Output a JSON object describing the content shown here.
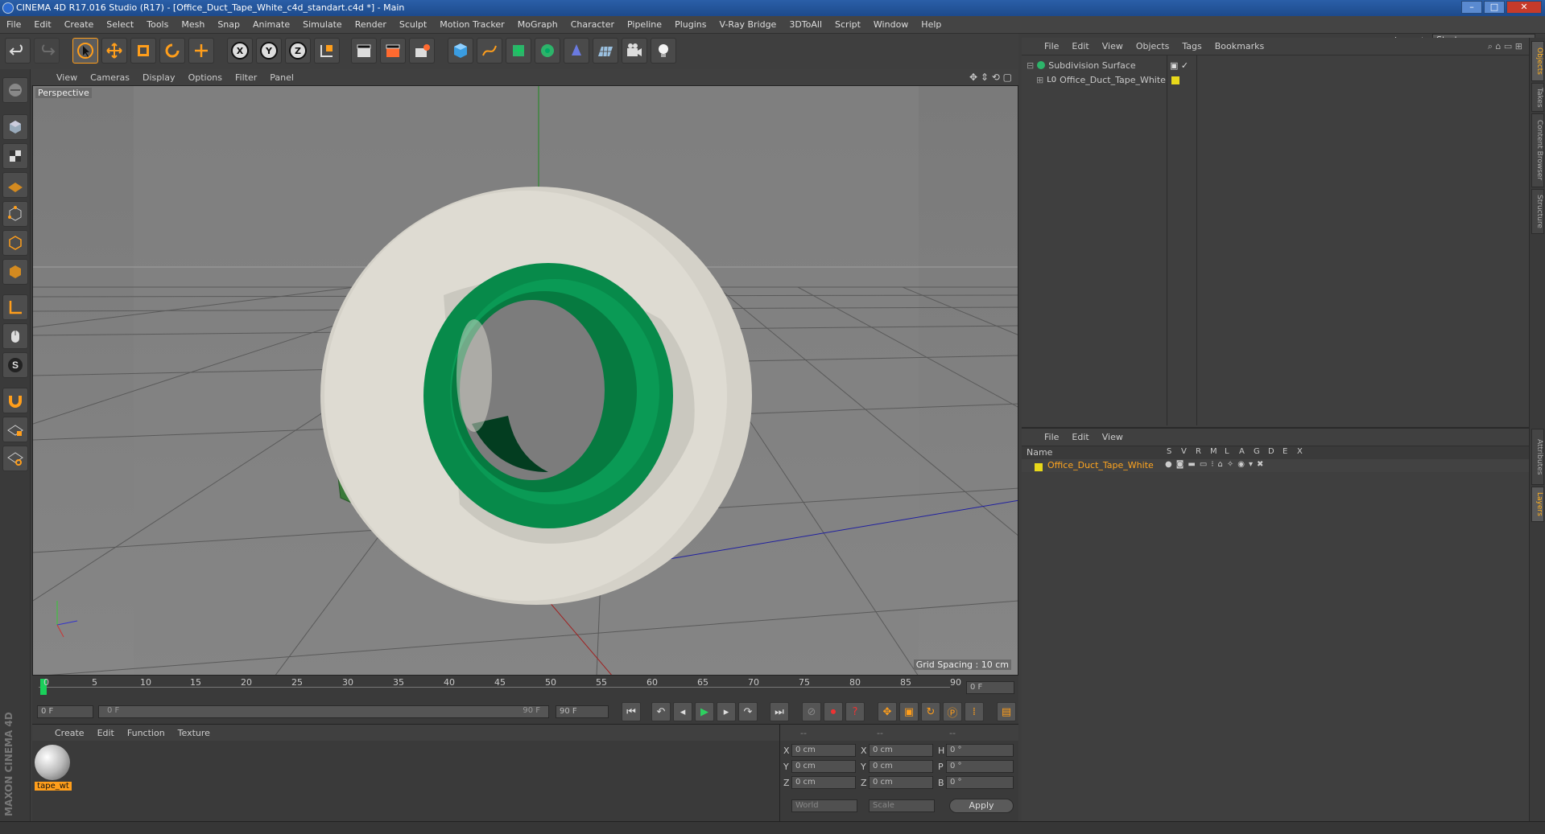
{
  "window": {
    "title": "CINEMA 4D R17.016 Studio (R17) - [Office_Duct_Tape_White_c4d_standart.c4d *] - Main",
    "min": "–",
    "max": "□",
    "close": "✕"
  },
  "menu": [
    "File",
    "Edit",
    "Create",
    "Select",
    "Tools",
    "Mesh",
    "Snap",
    "Animate",
    "Simulate",
    "Render",
    "Sculpt",
    "Motion Tracker",
    "MoGraph",
    "Character",
    "Pipeline",
    "Plugins",
    "V-Ray Bridge",
    "3DToAll",
    "Script",
    "Window",
    "Help"
  ],
  "layout": {
    "label": "Layout:",
    "value": "Startup"
  },
  "toolbar": {
    "x_label": "X",
    "y_label": "Y",
    "z_label": "Z"
  },
  "viewport": {
    "menu": [
      "View",
      "Cameras",
      "Display",
      "Options",
      "Filter",
      "Panel"
    ],
    "label": "Perspective",
    "grid_spacing": "Grid Spacing : 10 cm"
  },
  "timeline": {
    "ticks": [
      "0",
      "5",
      "10",
      "15",
      "20",
      "25",
      "30",
      "35",
      "40",
      "45",
      "50",
      "55",
      "60",
      "65",
      "70",
      "75",
      "80",
      "85",
      "90"
    ],
    "frame_field": "0 F"
  },
  "transport": {
    "start": "0 F",
    "range_start": "0 F",
    "range_end": "90 F",
    "end": "90 F"
  },
  "materials": {
    "menu": [
      "Create",
      "Edit",
      "Function",
      "Texture"
    ],
    "items": [
      {
        "name": "tape_wt"
      }
    ]
  },
  "coords": {
    "headers": [
      "--",
      "--",
      "--"
    ],
    "rows": [
      {
        "a": "X",
        "av": "0 cm",
        "b": "X",
        "bv": "0 cm",
        "c": "H",
        "cv": "0 °"
      },
      {
        "a": "Y",
        "av": "0 cm",
        "b": "Y",
        "bv": "0 cm",
        "c": "P",
        "cv": "0 °"
      },
      {
        "a": "Z",
        "av": "0 cm",
        "b": "Z",
        "bv": "0 cm",
        "c": "B",
        "cv": "0 °"
      }
    ],
    "world": "World",
    "scale": "Scale",
    "apply": "Apply"
  },
  "objects": {
    "menu": [
      "File",
      "Edit",
      "View",
      "Objects",
      "Tags",
      "Bookmarks"
    ],
    "items": [
      {
        "name": "Subdivision Surface"
      },
      {
        "name": "Office_Duct_Tape_White"
      }
    ]
  },
  "layers": {
    "menu": [
      "File",
      "Edit",
      "View"
    ],
    "name_col": "Name",
    "cols": [
      "S",
      "V",
      "R",
      "M",
      "L",
      "A",
      "G",
      "D",
      "E",
      "X"
    ],
    "items": [
      {
        "name": "Office_Duct_Tape_White"
      }
    ]
  },
  "side_tabs": [
    "Objects",
    "Takes",
    "Content Browser",
    "Structure",
    "Attributes",
    "Layers"
  ],
  "brand": "MAXON CINEMA 4D",
  "colors": {
    "accent": "#ffa51f",
    "tape_core": "#0a8a50",
    "tape_body": "#d8d6cc"
  }
}
